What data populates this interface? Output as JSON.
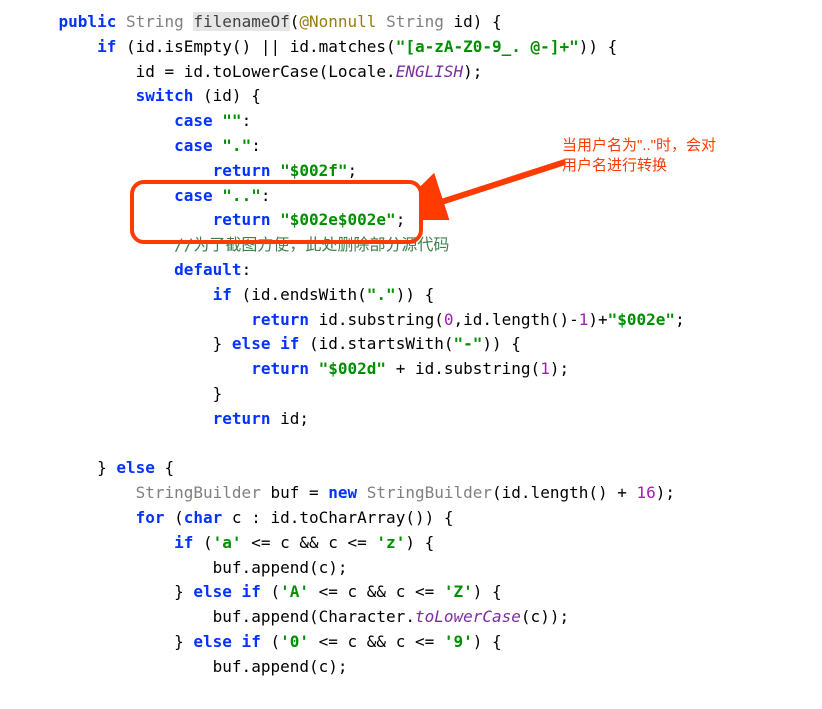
{
  "code": {
    "l1_public": "public",
    "l1_string": "String",
    "l1_method": "filenameOf",
    "l1_ann": "@Nonnull",
    "l1_string2": "String",
    "l1_param": " id) {",
    "l2_if": "if",
    "l2_rest": "(id.isEmpty() || id.matches(",
    "l2_str": "\"[a-zA-Z0-9_. @-]+\"",
    "l2_end": ")) {",
    "l3_pre": "id = id.toLowerCase(Locale.",
    "l3_en": "ENGLISH",
    "l3_end": ");",
    "l4_switch": "switch",
    "l4_rest": " (id) {",
    "l5_case": "case ",
    "l5_str": "\"\"",
    "l5_colon": ":",
    "l6_case": "case ",
    "l6_str": "\".\"",
    "l6_colon": ":",
    "l7_return": "return ",
    "l7_str": "\"$002f\"",
    "l7_semi": ";",
    "l8_case": "case ",
    "l8_str": "\"..\"",
    "l8_colon": ":",
    "l9_return": "return ",
    "l9_str": "\"$002e$002e\"",
    "l9_semi": ";",
    "l10_comment": "//为了截图方便，此处删除部分源代码",
    "l11_default": "default",
    "l11_colon": ":",
    "l12_if": "if",
    "l12_pre": " (id.endsWith(",
    "l12_str": "\".\"",
    "l12_end": ")) {",
    "l13_return": "return",
    "l13_mid": " id.substring(",
    "l13_zero": "0",
    "l13_mid2": ",id.length()-",
    "l13_one": "1",
    "l13_mid3": ")+",
    "l13_str": "\"$002e\"",
    "l13_semi": ";",
    "l14_else": "} else if",
    "l14_pre": " (id.startsWith(",
    "l14_str": "\"-\"",
    "l14_end": ")) {",
    "l15_return": "return ",
    "l15_str": "\"$002d\"",
    "l15_mid": " + id.substring(",
    "l15_one": "1",
    "l15_end": ");",
    "l16_close": "}",
    "l17_return": "return",
    "l17_rest": " id;",
    "l18_blank": "",
    "l19_else": "} else {",
    "l19_kw": "else",
    "l20_sb": "StringBuilder",
    "l20_mid": " buf = ",
    "l20_new": "new ",
    "l20_sb2": "StringBuilder",
    "l20_rest": "(id.length() + ",
    "l20_num": "16",
    "l20_end": ");",
    "l21_for": "for",
    "l21_pre": " (",
    "l21_char": "char",
    "l21_rest": " c : id.toCharArray()) {",
    "l22_if": "if",
    "l22_pre": " (",
    "l22_a": "'a'",
    "l22_mid": " <= c && c <= ",
    "l22_z": "'z'",
    "l22_end": ") {",
    "l23_buf": "buf.append(c);",
    "l24_else": "} else if",
    "l24_kw": "else if",
    "l24_pre": " (",
    "l24_A": "'A'",
    "l24_mid": " <= c && c <= ",
    "l24_Z": "'Z'",
    "l24_end": ") {",
    "l25_pre": "buf.append(Character.",
    "l25_tolower": "toLowerCase",
    "l25_end": "(c));",
    "l26_else": "} else if",
    "l26_pre": " (",
    "l26_0": "'0'",
    "l26_mid": " <= c && c <= ",
    "l26_9": "'9'",
    "l26_end": ") {",
    "l27_buf": "buf.append(c);"
  },
  "annotation": {
    "line1": "当用户名为\"..\"时，会对",
    "line2": "用户名进行转换"
  }
}
